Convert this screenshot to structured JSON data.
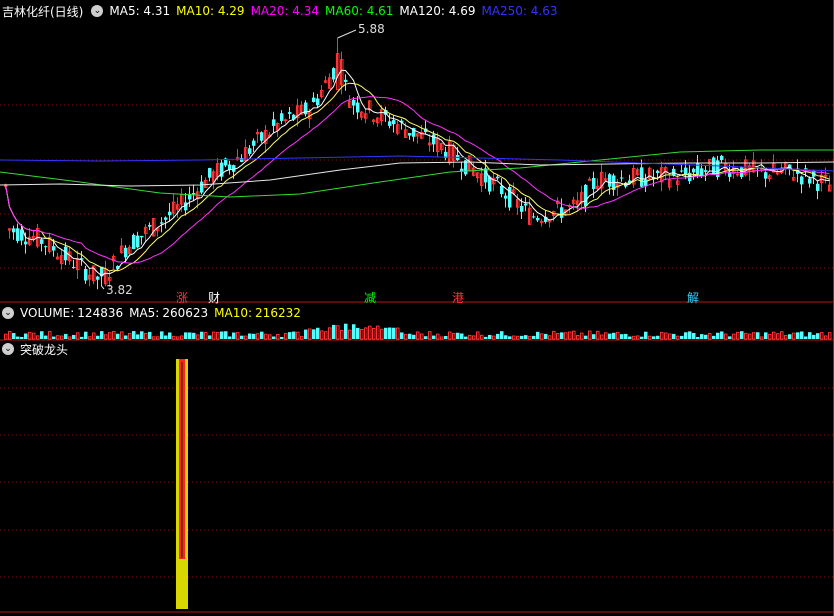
{
  "main_panel": {
    "title": "吉林化纤(日线)",
    "ma": [
      {
        "label": "MA5:",
        "value": "4.31",
        "color": "#ffffff"
      },
      {
        "label": "MA10:",
        "value": "4.29",
        "color": "#ffff00"
      },
      {
        "label": "MA20:",
        "value": "4.34",
        "color": "#ff00ff"
      },
      {
        "label": "MA60:",
        "value": "4.61",
        "color": "#00ff00"
      },
      {
        "label": "MA120:",
        "value": "4.69",
        "color": "#ffffff"
      },
      {
        "label": "MA250:",
        "value": "4.63",
        "color": "#3333ff"
      }
    ],
    "high_label": "5.88",
    "low_label": "3.82",
    "event_tags": [
      {
        "text": "涨",
        "color": "#ff3333"
      },
      {
        "text": "财",
        "color": "#ffffff"
      },
      {
        "text": "减",
        "color": "#00ff00"
      },
      {
        "text": "港",
        "color": "#ff3333"
      },
      {
        "text": "解",
        "color": "#33ccff"
      }
    ]
  },
  "volume_panel": {
    "label": "VOLUME:",
    "volume": "124836",
    "ma5_label": "MA5:",
    "ma5_value": "260623",
    "ma10_label": "MA10:",
    "ma10_value": "216232"
  },
  "indicator_panel": {
    "title": "突破龙头"
  },
  "colors": {
    "up": "#ff3333",
    "down": "#54ffff",
    "grid": "#8a1010",
    "separator": "#b01818"
  },
  "chart_data": {
    "type": "candlestick",
    "series_count": 205,
    "price_high": 5.88,
    "price_low": 3.82,
    "moving_averages": [
      "MA5",
      "MA10",
      "MA20",
      "MA60",
      "MA120",
      "MA250"
    ],
    "indicator_signal": {
      "name": "突破龙头",
      "bar_count": 1
    }
  }
}
